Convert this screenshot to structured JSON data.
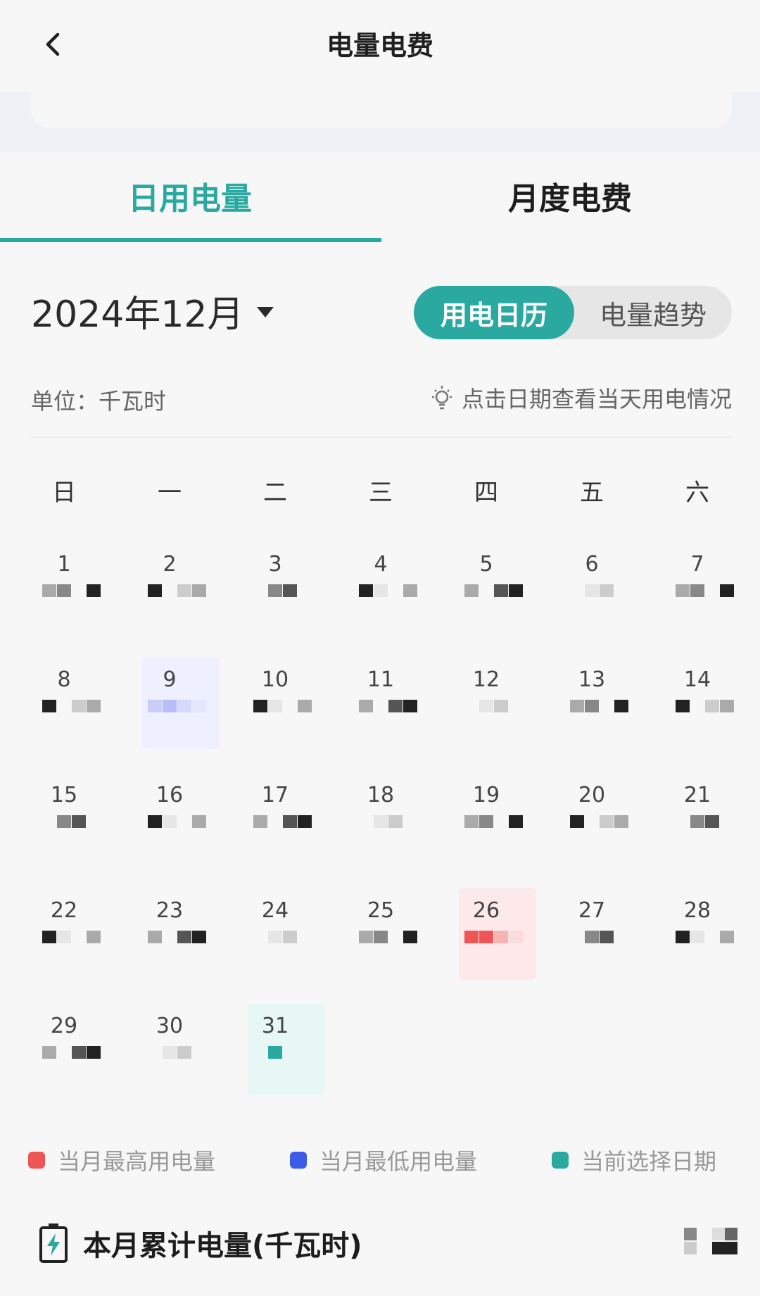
{
  "header": {
    "title": "电量电费"
  },
  "tabs": [
    {
      "label": "日用电量",
      "active": true
    },
    {
      "label": "月度电费",
      "active": false
    }
  ],
  "month_selector": {
    "label": "2024年12月"
  },
  "view_toggle": {
    "calendar": "用电日历",
    "trend": "电量趋势"
  },
  "unit_label": "单位：千瓦时",
  "tip": "点击日期查看当天用电情况",
  "weekdays": [
    "日",
    "一",
    "二",
    "三",
    "四",
    "五",
    "六"
  ],
  "calendar": {
    "days": [
      "1",
      "2",
      "3",
      "4",
      "5",
      "6",
      "7",
      "8",
      "9",
      "10",
      "11",
      "12",
      "13",
      "14",
      "15",
      "16",
      "17",
      "18",
      "19",
      "20",
      "21",
      "22",
      "23",
      "24",
      "25",
      "26",
      "27",
      "28",
      "29",
      "30",
      "31"
    ],
    "highest_day": "26",
    "lowest_day": "9",
    "selected_day": "31"
  },
  "legend": [
    {
      "label": "当月最高用电量",
      "color": "#f05555"
    },
    {
      "label": "当月最低用电量",
      "color": "#3b5be8"
    },
    {
      "label": "当前选择日期",
      "color": "#2aa9a1"
    }
  ],
  "total": {
    "label": "本月累计电量(千瓦时)"
  },
  "colors": {
    "accent": "#2aa9a1",
    "high": "#f05555",
    "low": "#3b5be8"
  }
}
